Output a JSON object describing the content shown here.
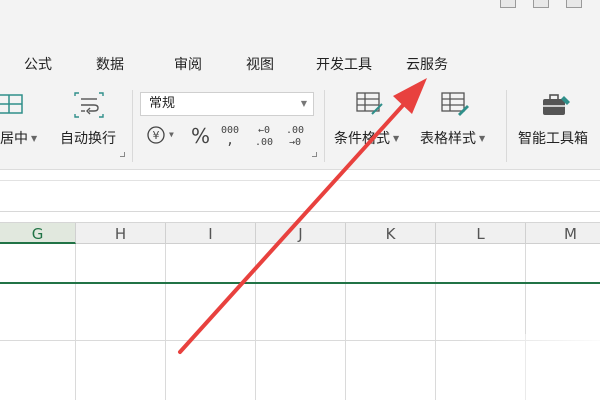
{
  "menu": {
    "tabs": [
      "公式",
      "数据",
      "审阅",
      "视图",
      "开发工具",
      "云服务"
    ]
  },
  "ribbon": {
    "merge_label": "居中",
    "wrap_label": "自动换行",
    "number_format": "常规",
    "percent_symbol": "%",
    "thousands_top": "000",
    "thousands_bottom": ",",
    "inc_decimal_top": "←0",
    "inc_decimal_bottom": ".00",
    "dec_decimal_top": ".00",
    "dec_decimal_bottom": "→0",
    "conditional_format_label": "条件格式",
    "table_style_label": "表格样式",
    "smart_toolbox_label": "智能工具箱"
  },
  "columns": [
    "G",
    "H",
    "I",
    "J",
    "K",
    "L",
    "M"
  ],
  "colors": {
    "accent_green": "#217346",
    "arrow_red": "#e8413e",
    "icon_teal": "#2f8f8a"
  }
}
